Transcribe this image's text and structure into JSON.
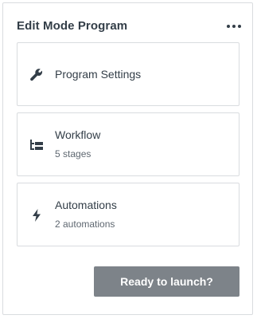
{
  "panel": {
    "title": "Edit Mode Program",
    "more_icon": "more-horizontal-icon"
  },
  "cards": [
    {
      "icon": "wrench-icon",
      "label": "Program Settings"
    },
    {
      "icon": "workflow-icon",
      "label": "Workflow",
      "sub": "5 stages"
    },
    {
      "icon": "lightning-icon",
      "label": "Automations",
      "sub": "2 automations"
    }
  ],
  "launch_button": {
    "label": "Ready to launch?"
  },
  "colors": {
    "text": "#333e48",
    "muted": "#5e6770",
    "border": "#d9dcdf",
    "button": "#7d8389"
  }
}
